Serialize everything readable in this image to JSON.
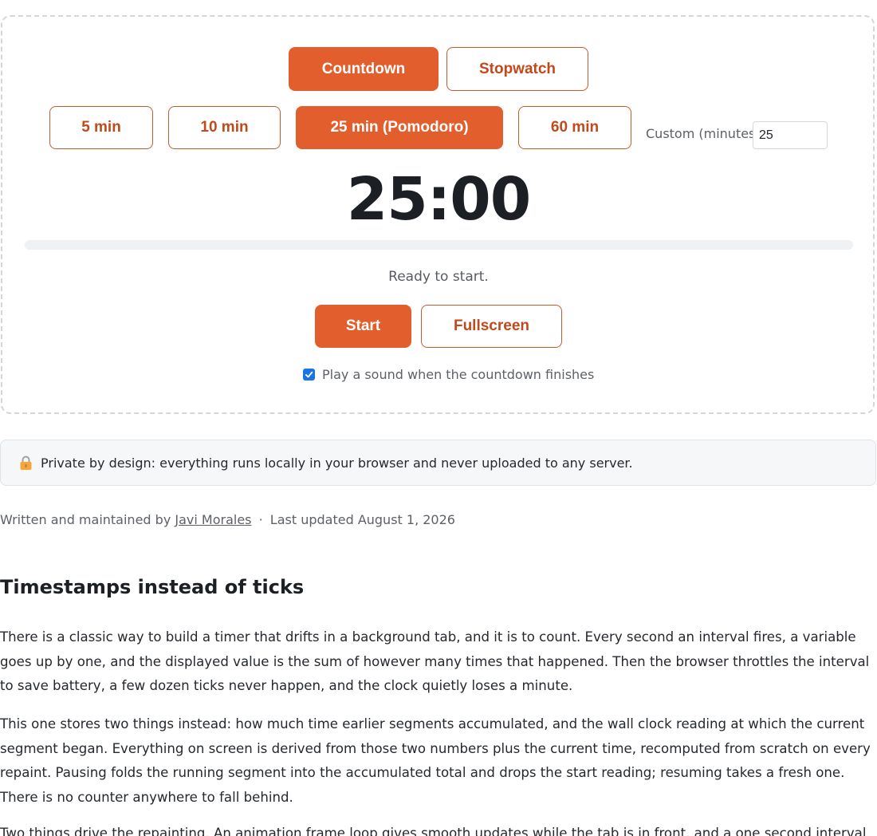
{
  "modes": {
    "countdown_label": "Countdown",
    "stopwatch_label": "Stopwatch",
    "selected": "Countdown"
  },
  "presets": {
    "items": [
      "5 min",
      "10 min",
      "25 min (Pomodoro)",
      "60 min"
    ],
    "selected": "25 min (Pomodoro)"
  },
  "custom": {
    "label": "Custom (minutes)",
    "value": "25"
  },
  "display": {
    "time": "25:00",
    "progress_percent": 0
  },
  "status": "Ready to start.",
  "controls": {
    "start_label": "Start",
    "fullscreen_label": "Fullscreen"
  },
  "sound": {
    "label": "Play a sound when the countdown finishes",
    "checked": true
  },
  "privacy": {
    "icon": "lock-icon",
    "text": "Private by design: everything runs locally in your browser and never uploaded to any server."
  },
  "byline": {
    "prefix": "Written and maintained by",
    "author": "Javi Morales",
    "separator": "·",
    "updated": "Last updated August 1, 2026"
  },
  "article": {
    "heading": "Timestamps instead of ticks",
    "paragraphs": [
      "There is a classic way to build a timer that drifts in a background tab, and it is to count. Every second an interval fires, a variable goes up by one, and the displayed value is the sum of however many times that happened. Then the browser throttles the interval to save battery, a few dozen ticks never happen, and the clock quietly loses a minute.",
      "This one stores two things instead: how much time earlier segments accumulated, and the wall clock reading at which the current segment began. Everything on screen is derived from those two numbers plus the current time, recomputed from scratch on every repaint. Pausing folds the running segment into the accumulated total and drops the start reading; resuming takes a fresh one. There is no counter anywhere to fall behind.",
      "Two things drive the repainting. An animation frame loop gives smooth updates while the tab is in front, and a one second interval"
    ]
  },
  "colors": {
    "accent": "#e25f2d",
    "accent_text": "#c04a1c",
    "checkbox": "#1a73e8"
  }
}
